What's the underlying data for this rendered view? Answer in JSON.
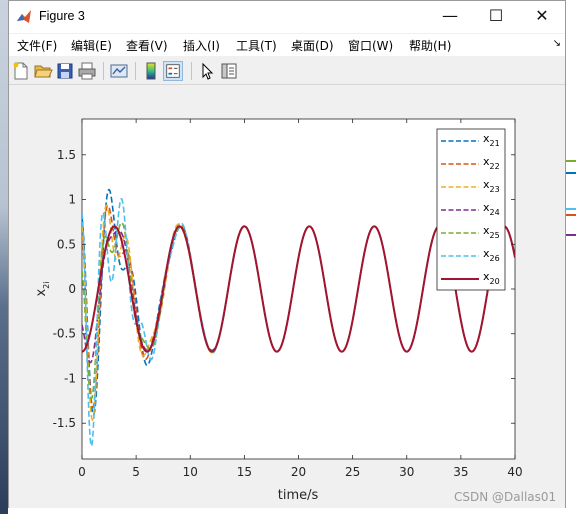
{
  "window": {
    "title": "Figure 3",
    "minimize_glyph": "—",
    "maximize_glyph": "☐",
    "close_glyph": "✕"
  },
  "menu": {
    "items": [
      {
        "label": "文件(F)",
        "accel": "F"
      },
      {
        "label": "编辑(E)",
        "accel": "E"
      },
      {
        "label": "查看(V)",
        "accel": "V"
      },
      {
        "label": "插入(I)",
        "accel": "I"
      },
      {
        "label": "工具(T)",
        "accel": "T"
      },
      {
        "label": "桌面(D)",
        "accel": "D"
      },
      {
        "label": "窗口(W)",
        "accel": "W"
      },
      {
        "label": "帮助(H)",
        "accel": "H"
      }
    ],
    "overflow_glyph": "↘"
  },
  "toolbar": {
    "icons": [
      "new-figure-icon",
      "open-file-icon",
      "save-icon",
      "print-icon",
      "link-plot-icon",
      "colorbar-icon",
      "legend-icon",
      "edit-plot-arrow-icon",
      "property-inspector-icon"
    ],
    "pressed": "legend-icon"
  },
  "chart_data": {
    "type": "line",
    "xlabel": "time/s",
    "ylabel": "x",
    "ylabel_sub": "2i",
    "xlim": [
      0,
      40
    ],
    "ylim": [
      -1.9,
      1.9
    ],
    "xticks": [
      0,
      5,
      10,
      15,
      20,
      25,
      30,
      35,
      40
    ],
    "yticks": [
      -1.5,
      -1,
      -0.5,
      0,
      0.5,
      1,
      1.5
    ],
    "ytick_labels": [
      "-1.5",
      "-1",
      "-0.5",
      "0",
      "0.5",
      "1",
      "1.5"
    ],
    "grid": false,
    "legend_position": "top-right",
    "reference": {
      "amplitude": 0.7,
      "period": 6.0,
      "phase": 0.0,
      "shape": "-0.7*cos(2*pi*t/6)"
    },
    "series": [
      {
        "name": "x",
        "sub": "21",
        "color": "#0072BD",
        "style": "dashed",
        "init": 0.8,
        "decay": 0.38
      },
      {
        "name": "x",
        "sub": "22",
        "color": "#D95319",
        "style": "dashed",
        "init": 0.6,
        "decay": 0.42
      },
      {
        "name": "x",
        "sub": "23",
        "color": "#EDB120",
        "style": "dashed",
        "init": 0.7,
        "decay": 0.4
      },
      {
        "name": "x",
        "sub": "24",
        "color": "#7E2F8E",
        "style": "dashed",
        "init": -0.4,
        "decay": 0.45
      },
      {
        "name": "x",
        "sub": "25",
        "color": "#77AC30",
        "style": "dashed",
        "init": 0.2,
        "decay": 0.43
      },
      {
        "name": "x",
        "sub": "26",
        "color": "#4DBEEE",
        "style": "dashed",
        "init": 0.85,
        "decay": 0.37
      },
      {
        "name": "x",
        "sub": "20",
        "color": "#A2142F",
        "style": "solid",
        "init": -0.7,
        "decay": 0.0
      }
    ]
  },
  "watermark": "CSDN @Dallas01"
}
